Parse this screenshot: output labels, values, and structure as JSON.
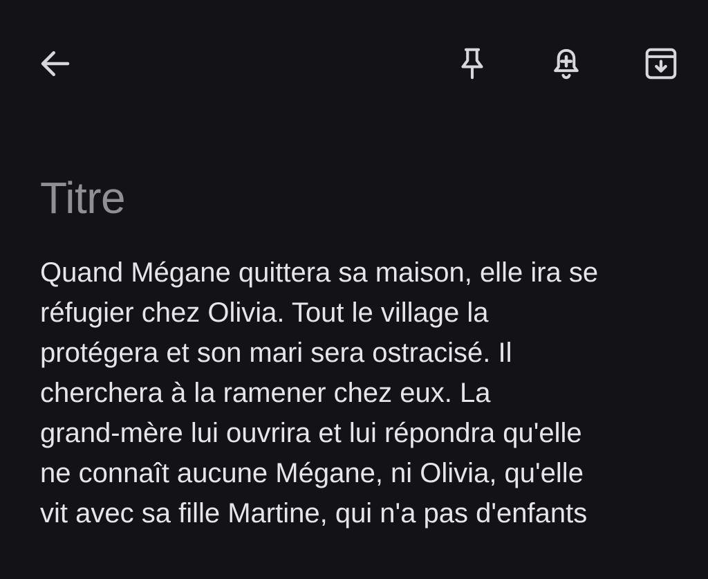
{
  "toolbar": {
    "back_icon": "arrow-left-icon",
    "pin_icon": "pin-icon",
    "reminder_icon": "bell-plus-icon",
    "archive_icon": "archive-down-icon",
    "icon_color": "#d7d7dc"
  },
  "note": {
    "title_placeholder": "Titre",
    "body": "Quand Mégane quittera sa maison, elle ira se\nréfugier chez Olivia. Tout le village la\nprotégera et son mari sera ostracisé. Il\ncherchera à la ramener chez eux. La\ngrand-mère lui ouvrira et lui répondra qu'elle\nne connaît aucune Mégane, ni Olivia, qu'elle\nvit avec sa fille Martine, qui n'a pas d'enfants"
  },
  "colors": {
    "background": "#131317",
    "title": "#8f8f94",
    "body": "#e6e6ea"
  }
}
